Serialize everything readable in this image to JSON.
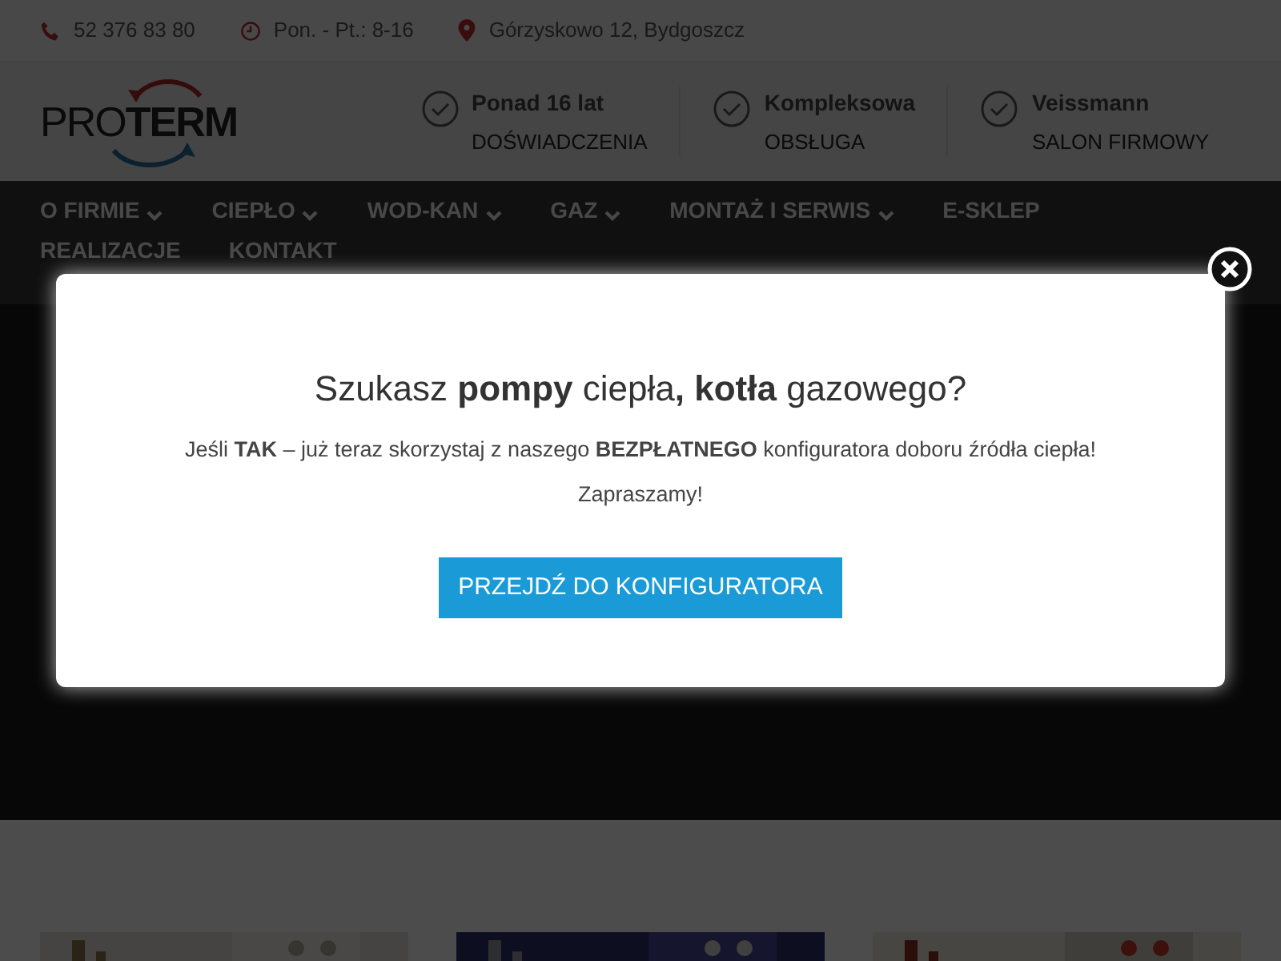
{
  "top_bar": [
    {
      "kind": "phone",
      "text": "52 376 83 80"
    },
    {
      "kind": "clock",
      "text": "Pon. - Pt.: 8-16"
    },
    {
      "kind": "pin",
      "text": "Górzyskowo 12, Bydgoszcz"
    }
  ],
  "logo": {
    "light": "PRO",
    "bold": "TERM"
  },
  "features": [
    {
      "title": "Ponad 16 lat",
      "subtitle": "DOŚWIADCZENIA"
    },
    {
      "title": "Kompleksowa",
      "subtitle": "OBSŁUGA"
    },
    {
      "title": "Veissmann",
      "subtitle": "SALON FIRMOWY"
    }
  ],
  "nav": [
    {
      "label": "O FIRMIE",
      "dropdown": true
    },
    {
      "label": "CIEPŁO",
      "dropdown": true
    },
    {
      "label": "WOD-KAN",
      "dropdown": true
    },
    {
      "label": "GAZ",
      "dropdown": true
    },
    {
      "label": "MONTAŻ I SERWIS",
      "dropdown": true
    },
    {
      "label": "E-SKLEP",
      "dropdown": false
    },
    {
      "label": "REALIZACJE",
      "dropdown": false
    },
    {
      "label": "KONTAKT",
      "dropdown": false
    }
  ],
  "modal": {
    "heading": "Szukasz **pompy** ciepła**, kotła** gazowego?",
    "text": "Jeśli **TAK** – już teraz skorzystaj z naszego **BEZPŁATNEGO** konfiguratora doboru źródła ciepła!",
    "note": "Zapraszamy!",
    "button": "PRZEJDŹ DO KONFIGURATORA"
  }
}
